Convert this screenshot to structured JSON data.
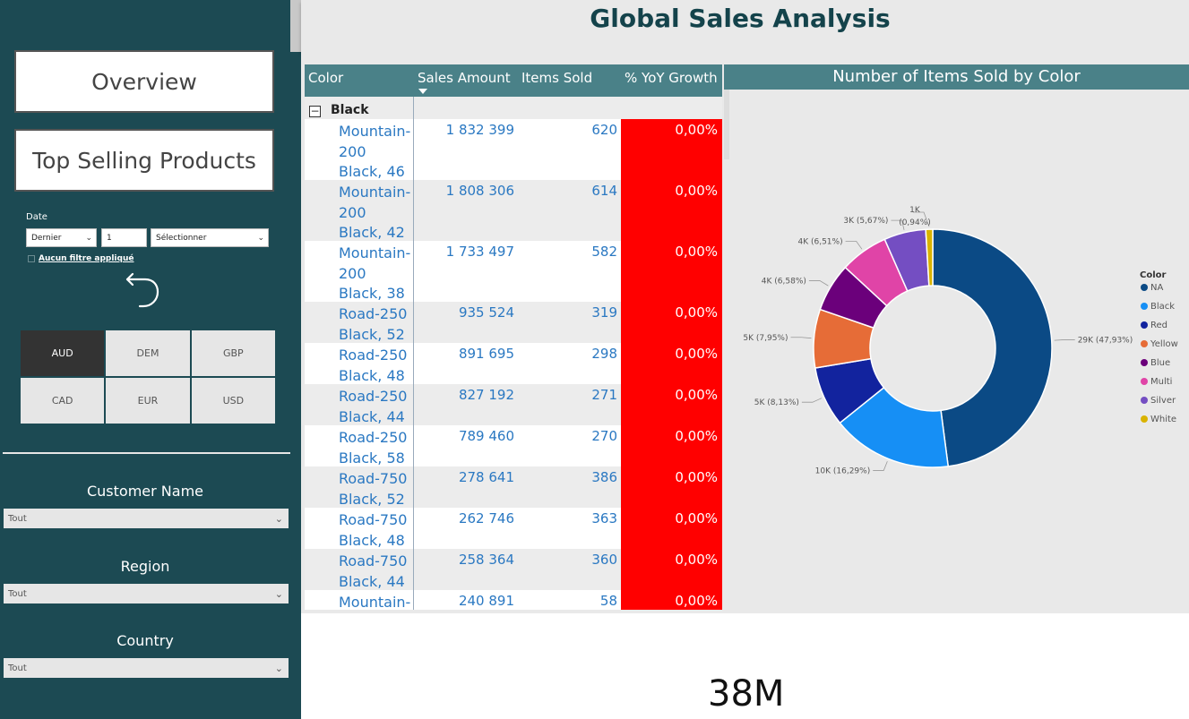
{
  "nav": {
    "overview_label": "Overview",
    "top_selling_label": "Top Selling Products"
  },
  "date_filter": {
    "label": "Date",
    "relative_option": "Dernier",
    "count": "1",
    "unit_placeholder": "Sélectionner",
    "no_filter_text": "Aucun filtre appliqué"
  },
  "currencies": [
    {
      "code": "AUD",
      "selected": true
    },
    {
      "code": "DEM",
      "selected": false
    },
    {
      "code": "GBP",
      "selected": false
    },
    {
      "code": "CAD",
      "selected": false
    },
    {
      "code": "EUR",
      "selected": false
    },
    {
      "code": "USD",
      "selected": false
    }
  ],
  "slicers": [
    {
      "title": "Customer Name",
      "value": "Tout"
    },
    {
      "title": "Region",
      "value": "Tout"
    },
    {
      "title": "Country",
      "value": "Tout"
    }
  ],
  "page_title": "Global Sales Analysis",
  "table": {
    "headers": [
      "Color",
      "Sales Amount",
      "Items Sold",
      "% YoY Growth"
    ],
    "group": "Black",
    "rows": [
      {
        "name": "Mountain-200 Black, 46",
        "sales": "1 832 399",
        "items": "620",
        "growth": "0,00%"
      },
      {
        "name": "Mountain-200 Black, 42",
        "sales": "1 808 306",
        "items": "614",
        "growth": "0,00%"
      },
      {
        "name": "Mountain-200 Black, 38",
        "sales": "1 733 497",
        "items": "582",
        "growth": "0,00%"
      },
      {
        "name": "Road-250 Black, 52",
        "sales": "935 524",
        "items": "319",
        "growth": "0,00%"
      },
      {
        "name": "Road-250 Black, 48",
        "sales": "891 695",
        "items": "298",
        "growth": "0,00%"
      },
      {
        "name": "Road-250 Black, 44",
        "sales": "827 192",
        "items": "271",
        "growth": "0,00%"
      },
      {
        "name": "Road-250 Black, 58",
        "sales": "789 460",
        "items": "270",
        "growth": "0,00%"
      },
      {
        "name": "Road-750 Black, 52",
        "sales": "278 641",
        "items": "386",
        "growth": "0,00%"
      },
      {
        "name": "Road-750 Black, 48",
        "sales": "262 746",
        "items": "363",
        "growth": "0,00%"
      },
      {
        "name": "Road-750 Black, 44",
        "sales": "258 364",
        "items": "360",
        "growth": "0,00%"
      },
      {
        "name": "Mountain-",
        "sales": "240 891",
        "items": "58",
        "growth": "0,00%"
      }
    ]
  },
  "chart_data": {
    "type": "pie",
    "title": "Number of Items Sold by Color",
    "legend_title": "Color",
    "legend_position": "right",
    "slices": [
      {
        "name": "NA",
        "value": 47.93,
        "label": "29K (47,93%)",
        "color": "#0b4a85"
      },
      {
        "name": "Black",
        "value": 16.29,
        "label": "10K (16,29%)",
        "color": "#168ff5"
      },
      {
        "name": "Red",
        "value": 8.13,
        "label": "5K (8,13%)",
        "color": "#12239e"
      },
      {
        "name": "Yellow",
        "value": 7.95,
        "label": "5K (7,95%)",
        "color": "#e66c37"
      },
      {
        "name": "Blue",
        "value": 6.58,
        "label": "4K (6,58%)",
        "color": "#6b007b"
      },
      {
        "name": "Multi",
        "value": 6.51,
        "label": "4K (6,51%)",
        "color": "#e044a7"
      },
      {
        "name": "Silver",
        "value": 5.67,
        "label": "3K (5,67%)",
        "color": "#744ec2"
      },
      {
        "name": "White",
        "value": 0.94,
        "label": "1K",
        "label2": "(0,94%)",
        "color": "#d9b300"
      }
    ]
  },
  "kpi_value": "38M"
}
